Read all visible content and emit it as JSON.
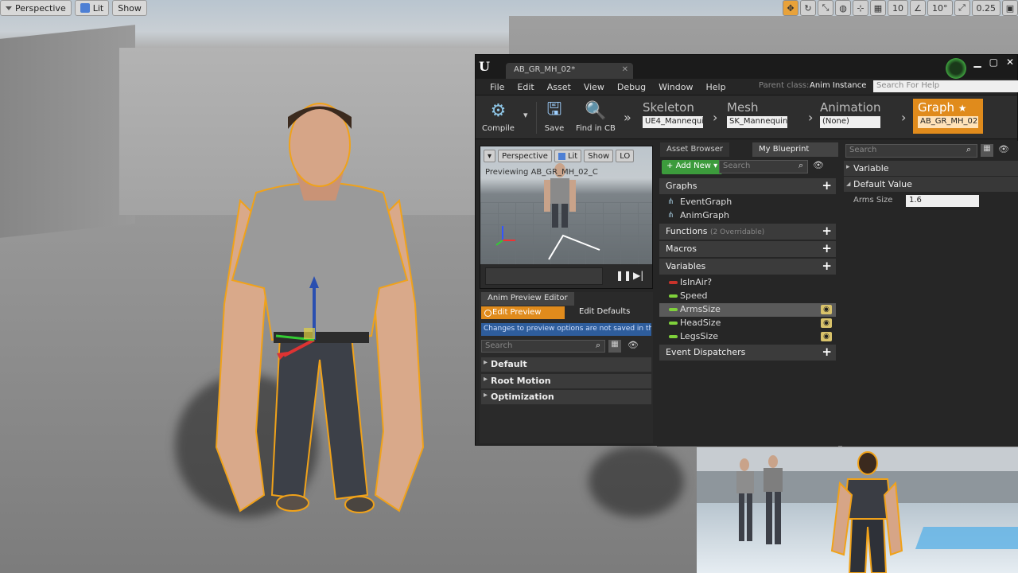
{
  "viewport": {
    "toolbar": {
      "perspective": "Perspective",
      "lit": "Lit",
      "show": "Show"
    },
    "right_toolbar": {
      "grid_snap": "10",
      "rotation_snap": "10°",
      "scale_snap": "0.25"
    }
  },
  "editor": {
    "document_tab": "AB_GR_MH_02*",
    "menu": [
      "File",
      "Edit",
      "Asset",
      "View",
      "Debug",
      "Window",
      "Help"
    ],
    "parent_class_label": "Parent class:",
    "parent_class_value": "Anim Instance",
    "help_search_placeholder": "Search For Help",
    "toolbar": {
      "compile": "Compile",
      "save": "Save",
      "find_in_cb": "Find in CB"
    },
    "modes": {
      "skeleton": {
        "label": "Skeleton",
        "value": "UE4_Mannequi"
      },
      "mesh": {
        "label": "Mesh",
        "value": "SK_Mannequin"
      },
      "animation": {
        "label": "Animation",
        "value": "(None)"
      },
      "graph": {
        "label": "Graph",
        "value": "AB_GR_MH_02"
      }
    },
    "preview": {
      "perspective": "Perspective",
      "lit": "Lit",
      "show": "Show",
      "lod": "LO",
      "previewing": "Previewing AB_GR_MH_02_C"
    },
    "anim_preview_editor": {
      "tab": "Anim Preview Editor",
      "edit_preview": "Edit Preview",
      "edit_defaults": "Edit Defaults",
      "note": "Changes to preview options are not saved in the a",
      "search_placeholder": "Search",
      "categories": [
        "Default",
        "Root Motion",
        "Optimization"
      ]
    },
    "my_blueprint": {
      "tab_asset_browser": "Asset Browser",
      "tab_my_blueprint": "My Blueprint",
      "add_new": "Add New",
      "search_placeholder": "Search",
      "graphs_label": "Graphs",
      "graphs": [
        "EventGraph",
        "AnimGraph"
      ],
      "functions_label": "Functions",
      "functions_sub": "(2 Overridable)",
      "macros_label": "Macros",
      "variables_label": "Variables",
      "variables": [
        {
          "name": "IsInAir?",
          "color": "#c8332b"
        },
        {
          "name": "Speed",
          "color": "#7fd13b"
        },
        {
          "name": "ArmsSize",
          "color": "#7fd13b"
        },
        {
          "name": "HeadSize",
          "color": "#7fd13b"
        },
        {
          "name": "LegsSize",
          "color": "#7fd13b"
        }
      ],
      "event_dispatchers_label": "Event Dispatchers"
    },
    "details": {
      "search_placeholder": "Search",
      "variable_section": "Variable",
      "default_value_section": "Default Value",
      "arms_size_label": "Arms Size",
      "arms_size_value": "1.6"
    }
  },
  "colors": {
    "accent_orange": "#e08b1c",
    "add_new_green": "#3c9b3c",
    "selection_outline": "#f0a21a"
  }
}
